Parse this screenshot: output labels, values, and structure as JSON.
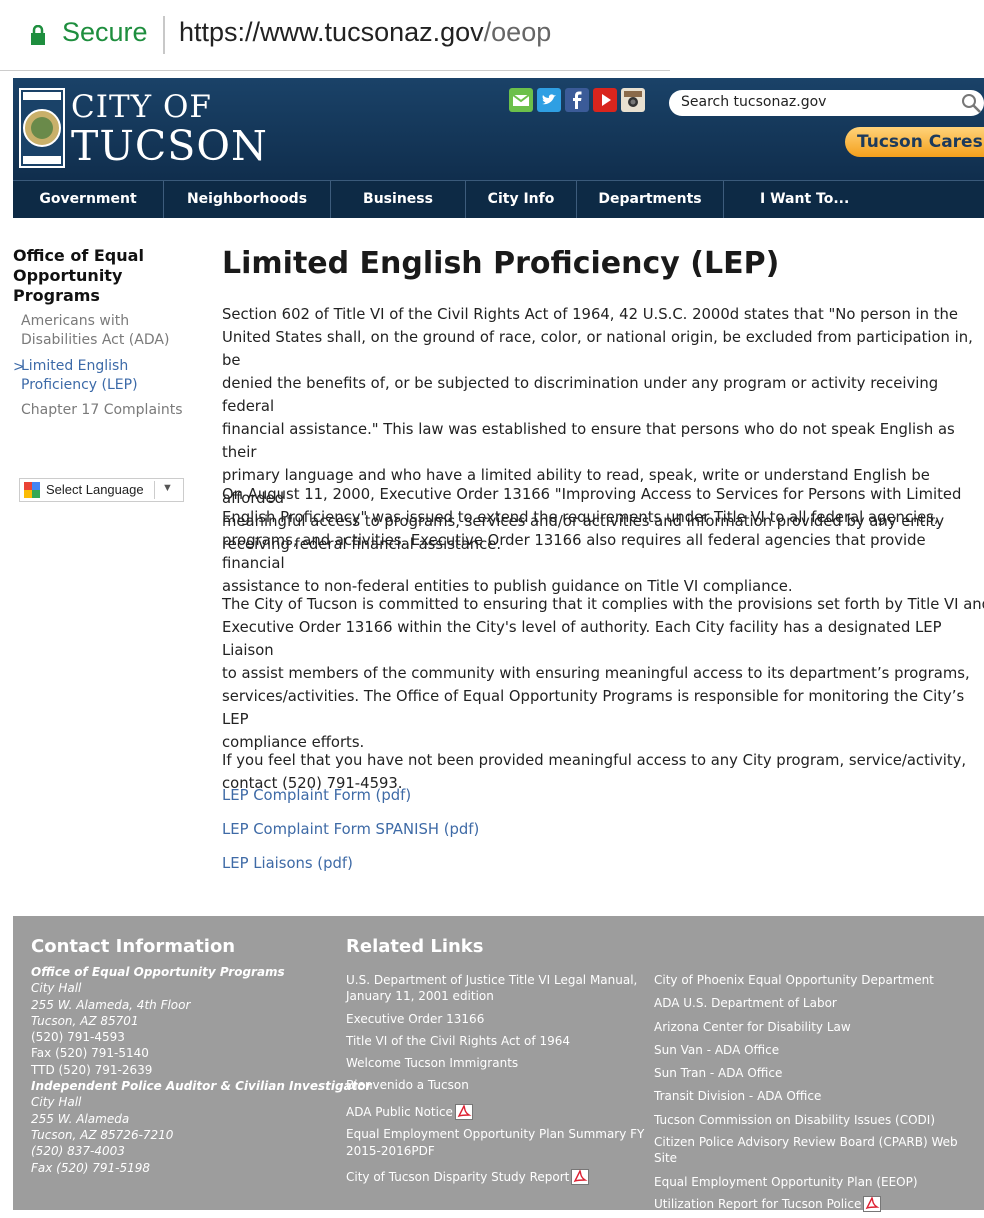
{
  "browser": {
    "secure_label": "Secure",
    "url_host": "https://www.tucsonaz.gov",
    "url_path": "/oeop"
  },
  "header": {
    "logo_line1": "CITY OF",
    "logo_line2": "TUCSON",
    "search_placeholder": "Search tucsonaz.gov",
    "cares_label": "Tucson Cares",
    "social_icons": [
      "email-icon",
      "twitter-icon",
      "facebook-icon",
      "youtube-icon",
      "instagram-icon"
    ]
  },
  "nav": [
    "Government",
    "Neighborhoods",
    "Business",
    "City Info",
    "Departments",
    "I Want To..."
  ],
  "sidebar": {
    "title_lines": [
      "Office of Equal",
      "Opportunity",
      "Programs"
    ],
    "links": [
      {
        "lines": [
          "Americans with",
          "Disabilities Act (ADA)"
        ],
        "active": false
      },
      {
        "lines": [
          "Limited English",
          "Proficiency (LEP)"
        ],
        "active": true
      },
      {
        "lines": [
          "Chapter 17 Complaints"
        ],
        "active": false
      }
    ],
    "language_label": "Select Language"
  },
  "main": {
    "title": "Limited English Proficiency (LEP)",
    "paragraphs": [
      [
        "Section 602 of Title VI of the Civil Rights Act of 1964, 42 U.S.C. 2000d states that \"No person in the",
        "United States shall, on the ground of race, color, or national origin, be excluded from participation in, be",
        "denied the benefits of, or be subjected to discrimination under any program or activity receiving federal",
        "financial assistance.\" This law was established to ensure that persons who do not speak English as their",
        "primary language and who have a limited ability to read, speak, write or understand English be afforded",
        "meaningful access to programs, services and/or activities and information provided by any entity",
        "receiving federal financial assistance."
      ],
      [
        "On August 11, 2000, Executive Order 13166 \"Improving Access to Services for Persons with Limited",
        "English Proficiency\" was issued to extend the requirements under Title VI to all federal agencies,",
        "programs, and activities. Executive Order 13166 also requires all federal agencies that provide financial",
        "assistance to non-federal entities to publish guidance on Title VI compliance."
      ],
      [
        "The City of Tucson is committed to ensuring that it complies with the provisions set forth by Title VI and",
        "Executive Order 13166 within the City's level of authority. Each City facility has a designated LEP Liaison",
        "to assist members of the community with ensuring meaningful access to its department’s programs,",
        "services/activities. The Office of Equal Opportunity Programs is responsible for monitoring the City’s LEP",
        "compliance efforts."
      ],
      [
        "If you feel that you have not been provided meaningful access to any City program, service/activity,",
        "contact (520) 791-4593."
      ]
    ],
    "downloads": [
      "LEP Complaint Form (pdf)",
      "LEP Complaint Form SPANISH (pdf)",
      "LEP Liaisons (pdf)"
    ]
  },
  "footer": {
    "contact_heading": "Contact Information",
    "contact_lines": [
      {
        "t": "Office of Equal Opportunity Programs",
        "s": "b"
      },
      {
        "t": "City Hall",
        "s": "it"
      },
      {
        "t": "255 W. Alameda, 4th Floor",
        "s": "it"
      },
      {
        "t": "Tucson, AZ 85701",
        "s": "it"
      },
      {
        "t": "(520) 791-4593",
        "s": ""
      },
      {
        "t": "Fax (520) 791-5140",
        "s": ""
      },
      {
        "t": "TTD (520) 791-2639",
        "s": ""
      },
      {
        "t": "Independent Police Auditor & Civilian Investigator",
        "s": "b"
      },
      {
        "t": "City Hall",
        "s": "it"
      },
      {
        "t": "255 W. Alameda",
        "s": "it"
      },
      {
        "t": "Tucson, AZ 85726-7210",
        "s": "it"
      },
      {
        "t": "(520) 837-4003",
        "s": "it"
      },
      {
        "t": "Fax (520) 791-5198",
        "s": "it"
      }
    ],
    "related_heading": "Related Links",
    "related_col1": [
      {
        "lines": [
          "U.S. Department of Justice Title VI Legal Manual,",
          "January 11, 2001 edition"
        ],
        "pdf": false
      },
      {
        "lines": [
          "Executive Order 13166"
        ],
        "pdf": false
      },
      {
        "lines": [
          "Title VI of the Civil Rights Act of 1964"
        ],
        "pdf": false
      },
      {
        "lines": [
          "Welcome Tucson Immigrants"
        ],
        "pdf": false
      },
      {
        "lines": [
          "Bienvenido a Tucson"
        ],
        "pdf": false
      },
      {
        "lines": [
          "ADA Public Notice"
        ],
        "pdf": true
      },
      {
        "lines": [
          "Equal Employment Opportunity Plan Summary FY",
          "2015-2016PDF"
        ],
        "pdf": false
      },
      {
        "lines": [
          "City of Tucson Disparity Study Report"
        ],
        "pdf": true
      }
    ],
    "related_col2": [
      {
        "lines": [
          "City of Phoenix Equal Opportunity Department"
        ],
        "pdf": false
      },
      {
        "lines": [
          "ADA U.S. Department of Labor"
        ],
        "pdf": false
      },
      {
        "lines": [
          "Arizona Center for Disability Law"
        ],
        "pdf": false
      },
      {
        "lines": [
          "Sun Van - ADA Office"
        ],
        "pdf": false
      },
      {
        "lines": [
          "Sun Tran - ADA Office"
        ],
        "pdf": false
      },
      {
        "lines": [
          "Transit Division - ADA Office"
        ],
        "pdf": false
      },
      {
        "lines": [
          "Tucson Commission on Disability Issues (CODI)"
        ],
        "pdf": false
      },
      {
        "lines": [
          "Citizen Police Advisory Review Board (CPARB) Web",
          "Site"
        ],
        "pdf": false
      },
      {
        "lines": [
          "Equal Employment Opportunity Plan (EEOP)"
        ],
        "pdf": false
      },
      {
        "lines": [
          "Utilization Report for Tucson Police"
        ],
        "pdf": true
      }
    ]
  },
  "colors": {
    "header_bg": "#123556",
    "nav_bg": "#0d2a45",
    "link_blue": "#3e6aa6",
    "footer_bg": "#9d9d9d",
    "cares_orange": "#f4a01c",
    "secure_green": "#1e8e3e"
  }
}
